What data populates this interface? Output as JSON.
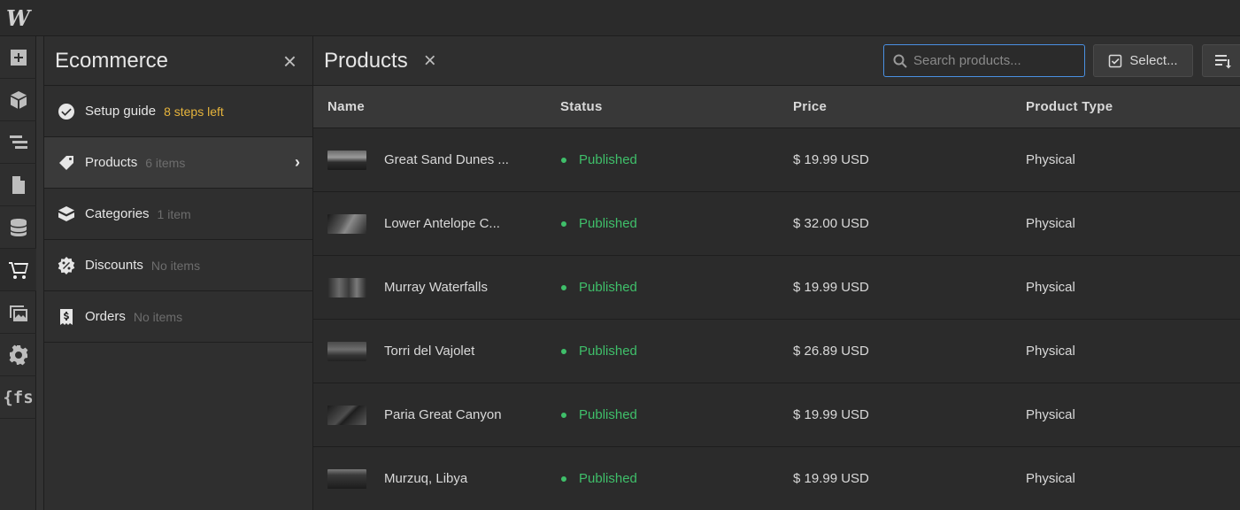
{
  "app": {
    "logo": "W"
  },
  "rail": {
    "items": [
      {
        "icon": "add-panel-icon"
      },
      {
        "icon": "cube-icon"
      },
      {
        "icon": "navigator-icon"
      },
      {
        "icon": "page-icon"
      },
      {
        "icon": "database-icon"
      },
      {
        "icon": "cart-icon",
        "active": true
      },
      {
        "icon": "assets-icon"
      },
      {
        "icon": "gear-icon"
      },
      {
        "icon": "finsweet-icon",
        "glyph": "{fs"
      }
    ]
  },
  "panel": {
    "title": "Ecommerce",
    "close": "×",
    "items": [
      {
        "label": "Setup guide",
        "meta": "8 steps left",
        "icon": "check-circle-icon"
      },
      {
        "label": "Products",
        "meta": "6 items",
        "icon": "tag-icon",
        "chevron": "›"
      },
      {
        "label": "Categories",
        "meta": "1 item",
        "icon": "box-icon"
      },
      {
        "label": "Discounts",
        "meta": "No items",
        "icon": "discount-badge-icon"
      },
      {
        "label": "Orders",
        "meta": "No items",
        "icon": "receipt-icon"
      }
    ]
  },
  "main": {
    "title": "Products",
    "close": "×",
    "search_placeholder": "Search products...",
    "select_label": "Select...",
    "columns": [
      "Name",
      "Status",
      "Price",
      "Product Type"
    ],
    "rows": [
      {
        "name": "Great Sand Dunes ...",
        "status": "Published",
        "price": "$ 19.99 USD",
        "type": "Physical"
      },
      {
        "name": "Lower Antelope C...",
        "status": "Published",
        "price": "$ 32.00 USD",
        "type": "Physical"
      },
      {
        "name": "Murray Waterfalls",
        "status": "Published",
        "price": "$ 19.99 USD",
        "type": "Physical"
      },
      {
        "name": "Torri del Vajolet",
        "status": "Published",
        "price": "$ 26.89 USD",
        "type": "Physical"
      },
      {
        "name": "Paria Great Canyon",
        "status": "Published",
        "price": "$ 19.99 USD",
        "type": "Physical"
      },
      {
        "name": "Murzuq, Libya",
        "status": "Published",
        "price": "$ 19.99 USD",
        "type": "Physical"
      }
    ]
  },
  "colors": {
    "published": "#3fbf6a",
    "warning": "#e6b43c",
    "focus": "#4a90e2"
  }
}
